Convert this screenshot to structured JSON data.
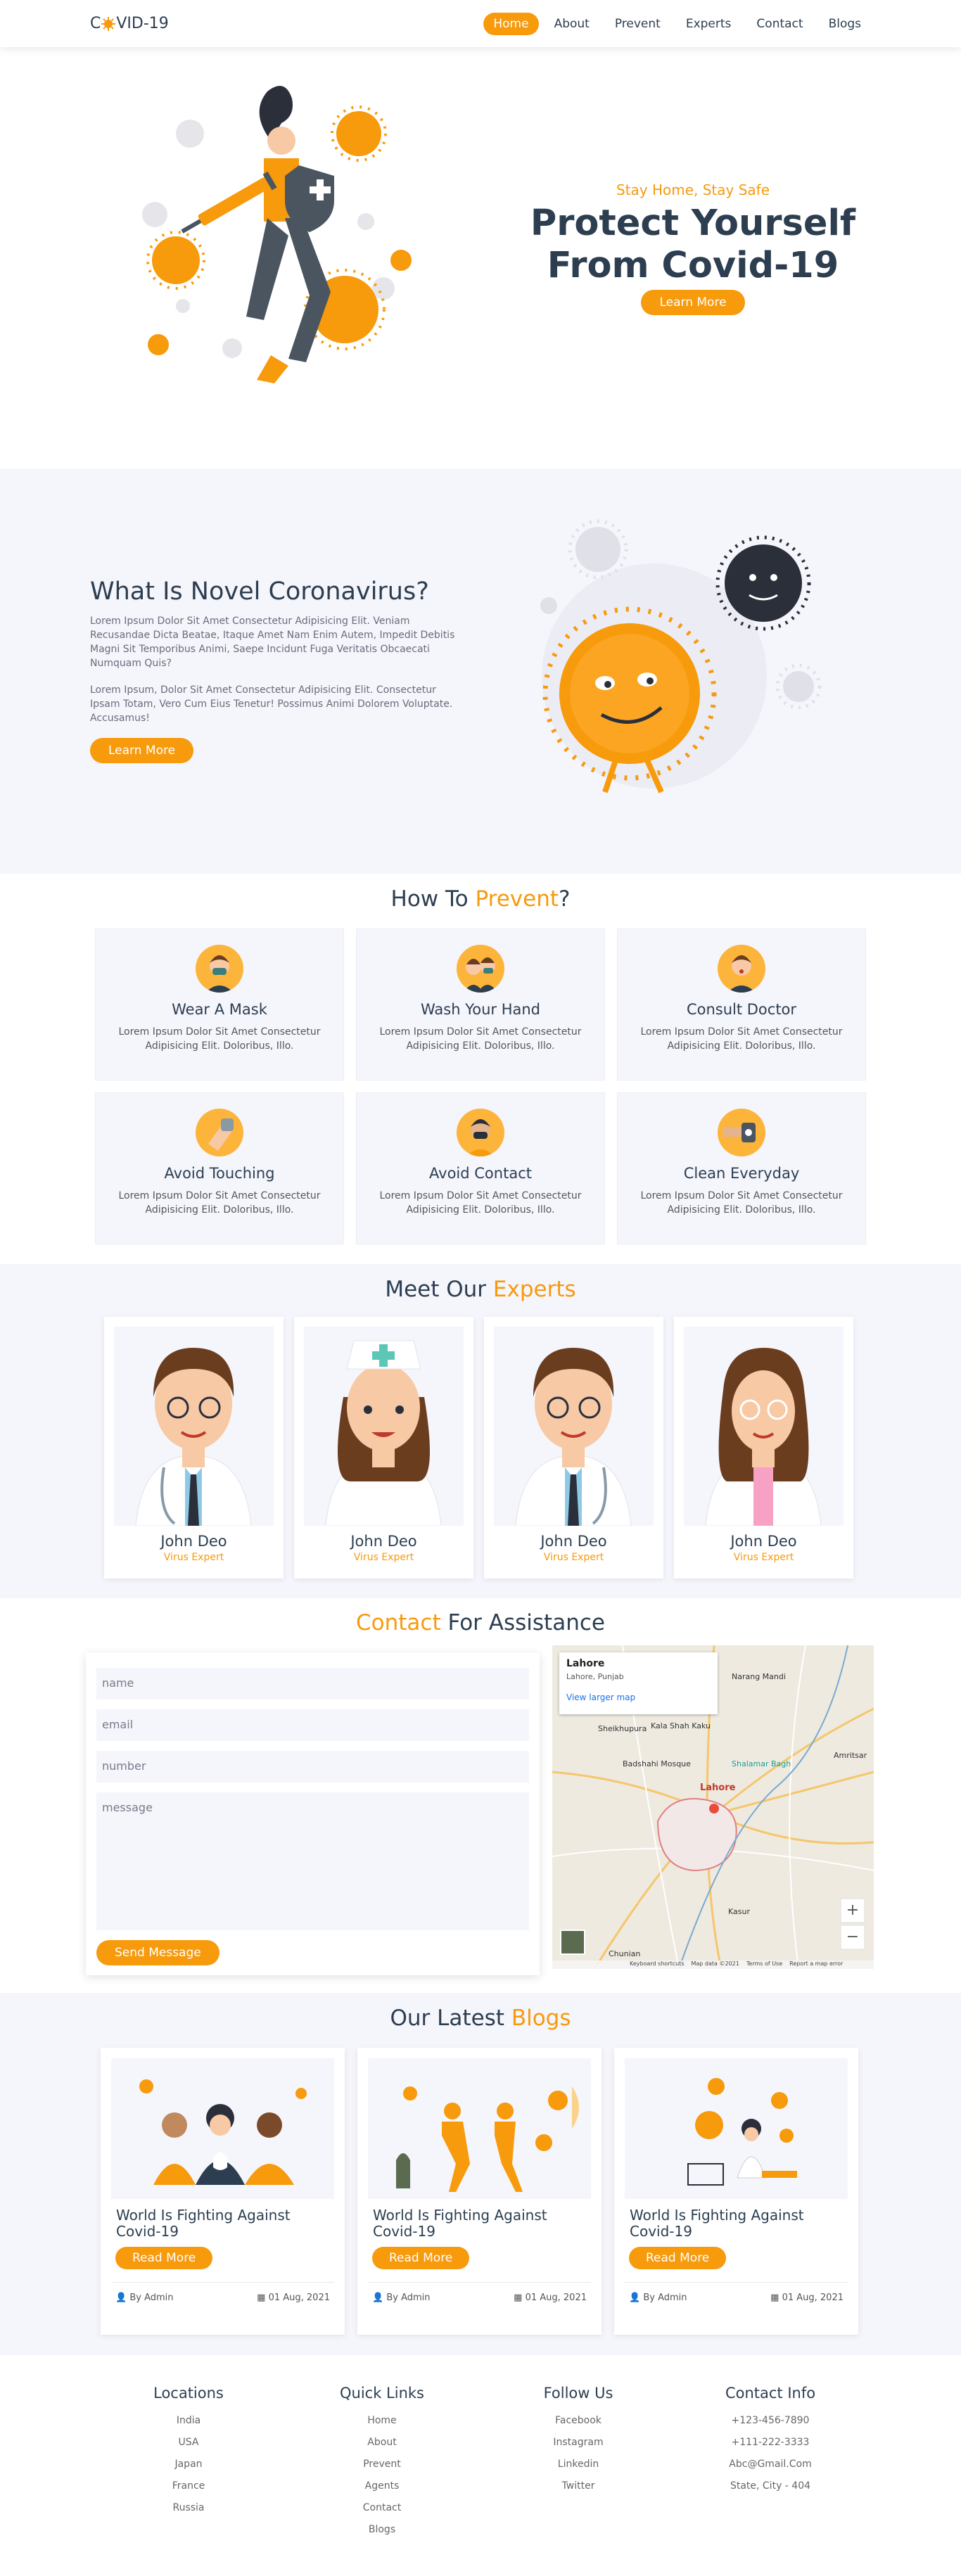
{
  "header": {
    "logo_prefix": "C",
    "logo_suffix": "VID-19",
    "nav": [
      "Home",
      "About",
      "Prevent",
      "Experts",
      "Contact",
      "Blogs"
    ]
  },
  "hero": {
    "subtitle": "Stay Home, Stay Safe",
    "title_line1": "Protect Yourself",
    "title_line2": "From Covid-19",
    "button": "Learn More"
  },
  "about": {
    "title": "What Is Novel Coronavirus?",
    "para1": "Lorem Ipsum Dolor Sit Amet Consectetur Adipisicing Elit. Veniam Recusandae Dicta Beatae, Itaque Amet Nam Enim Autem, Impedit Debitis Magni Sit Temporibus Animi, Saepe Incidunt Fuga Veritatis Obcaecati Numquam Quis?",
    "para2": "Lorem Ipsum, Dolor Sit Amet Consectetur Adipisicing Elit. Consectetur Ipsam Totam, Vero Cum Eius Tenetur! Possimus Animi Dolorem Voluptate. Accusamus!",
    "button": "Learn More"
  },
  "prevent": {
    "title_a": "How To ",
    "title_b": "Prevent",
    "title_c": "?",
    "items": [
      {
        "title": "Wear A Mask",
        "text": "Lorem Ipsum Dolor Sit Amet Consectetur Adipisicing Elit. Doloribus, Illo."
      },
      {
        "title": "Wash Your Hand",
        "text": "Lorem Ipsum Dolor Sit Amet Consectetur Adipisicing Elit. Doloribus, Illo."
      },
      {
        "title": "Consult Doctor",
        "text": "Lorem Ipsum Dolor Sit Amet Consectetur Adipisicing Elit. Doloribus, Illo."
      },
      {
        "title": "Avoid Touching",
        "text": "Lorem Ipsum Dolor Sit Amet Consectetur Adipisicing Elit. Doloribus, Illo."
      },
      {
        "title": "Avoid Contact",
        "text": "Lorem Ipsum Dolor Sit Amet Consectetur Adipisicing Elit. Doloribus, Illo."
      },
      {
        "title": "Clean Everyday",
        "text": "Lorem Ipsum Dolor Sit Amet Consectetur Adipisicing Elit. Doloribus, Illo."
      }
    ]
  },
  "experts": {
    "title_a": "Meet Our ",
    "title_b": "Experts",
    "items": [
      {
        "name": "John Deo",
        "role": "Virus Expert"
      },
      {
        "name": "John Deo",
        "role": "Virus Expert"
      },
      {
        "name": "John Deo",
        "role": "Virus Expert"
      },
      {
        "name": "John Deo",
        "role": "Virus Expert"
      }
    ]
  },
  "contact": {
    "title_a": "Contact",
    "title_b": " For Assistance",
    "placeholders": {
      "name": "name",
      "email": "email",
      "number": "number",
      "message": "message"
    },
    "button": "Send Message",
    "map": {
      "place": "Lahore",
      "region": "Lahore, Punjab",
      "larger_map": "View larger map",
      "labels": [
        "Sheikhupura",
        "Badshahi Mosque",
        "Shalamar Bagh",
        "Lahore",
        "Amritsar",
        "Kasur",
        "Chunian",
        "Narang Mandi",
        "Kala Shah Kaku"
      ],
      "footer": [
        "Keyboard shortcuts",
        "Map data ©2021",
        "Terms of Use",
        "Report a map error"
      ],
      "zoom_in": "+",
      "zoom_out": "−"
    }
  },
  "blogs": {
    "title_a": "Our Latest ",
    "title_b": "Blogs",
    "items": [
      {
        "title": "World Is Fighting Against Covid-19",
        "button": "Read More",
        "author": "By Admin",
        "date": "01 Aug, 2021"
      },
      {
        "title": "World Is Fighting Against Covid-19",
        "button": "Read More",
        "author": "By Admin",
        "date": "01 Aug, 2021"
      },
      {
        "title": "World Is Fighting Against Covid-19",
        "button": "Read More",
        "author": "By Admin",
        "date": "01 Aug, 2021"
      }
    ]
  },
  "footer": {
    "locations": {
      "title": "Locations",
      "items": [
        "India",
        "USA",
        "Japan",
        "France",
        "Russia"
      ]
    },
    "quick_links": {
      "title": "Quick Links",
      "items": [
        "Home",
        "About",
        "Prevent",
        "Agents",
        "Contact",
        "Blogs"
      ]
    },
    "follow": {
      "title": "Follow Us",
      "items": [
        "Facebook",
        "Instagram",
        "Linkedin",
        "Twitter"
      ]
    },
    "contact_info": {
      "title": "Contact Info",
      "items": [
        "+123-456-7890",
        "+111-222-3333",
        "Abc@Gmail.Com",
        "State, City - 404"
      ]
    }
  },
  "colors": {
    "accent": "#f79a0c",
    "dark": "#2c3e50",
    "light_bg": "#f5f5fc"
  }
}
